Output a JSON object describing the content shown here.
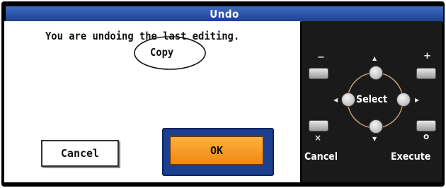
{
  "dialog": {
    "title": "Undo",
    "message_line1": "You are undoing the last editing.",
    "message_line2": "Copy",
    "cancel_label": "Cancel",
    "ok_label": "OK"
  },
  "panel": {
    "minus_symbol": "−",
    "plus_symbol": "+",
    "cancel_symbol": "×",
    "execute_symbol": "o",
    "select_label": "Select",
    "cancel_label": "Cancel",
    "execute_label": "Execute"
  },
  "colors": {
    "title_bar": "#1d3f8f",
    "ok_button": "#f08a10",
    "highlight_frame": "#1d3f8f"
  }
}
